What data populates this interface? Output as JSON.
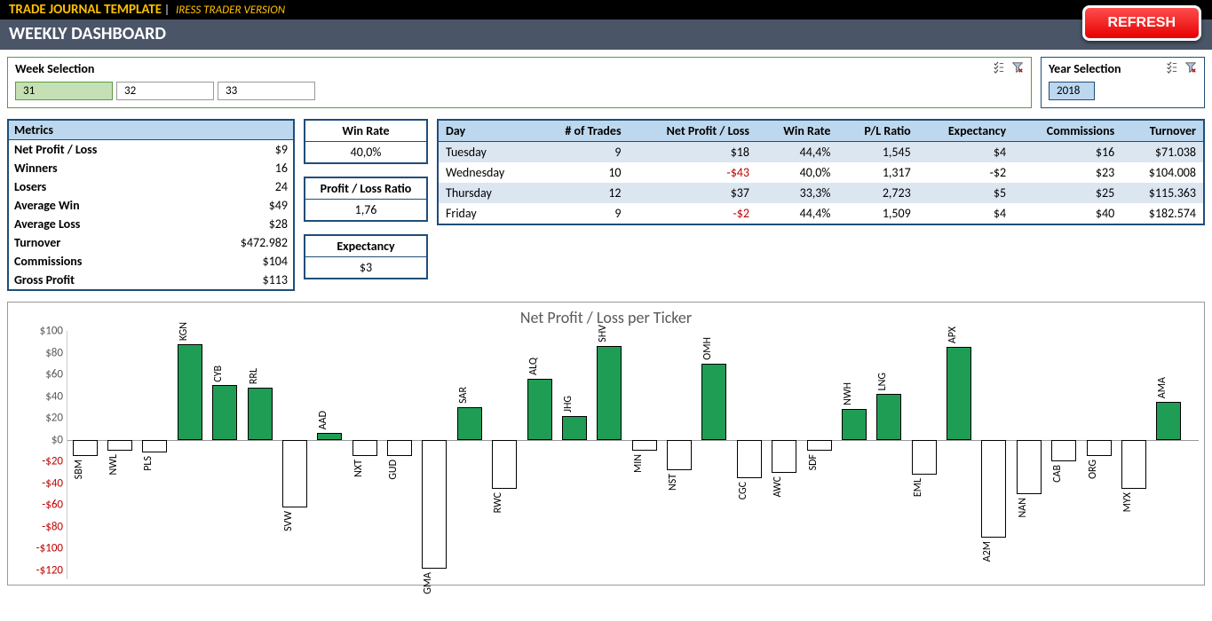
{
  "header": {
    "title": "TRADE JOURNAL TEMPLATE",
    "separator": "|",
    "subtitle": "IRESS TRADER VERSION",
    "dashboard_title": "WEEKLY DASHBOARD",
    "refresh_label": "REFRESH"
  },
  "week_selection": {
    "title": "Week Selection",
    "items": [
      "31",
      "32",
      "33"
    ],
    "selected_index": 0
  },
  "year_selection": {
    "title": "Year Selection",
    "items": [
      "2018"
    ]
  },
  "metrics": {
    "header": "Metrics",
    "rows": [
      {
        "label": "Net Profit / Loss",
        "value": "$9"
      },
      {
        "label": "Winners",
        "value": "16"
      },
      {
        "label": "Losers",
        "value": "24"
      },
      {
        "label": "Average Win",
        "value": "$49"
      },
      {
        "label": "Average Loss",
        "value": "$28"
      },
      {
        "label": "Turnover",
        "value": "$472.982"
      },
      {
        "label": "Commissions",
        "value": "$104"
      },
      {
        "label": "Gross Profit",
        "value": "$113"
      }
    ]
  },
  "stat_boxes": [
    {
      "title": "Win Rate",
      "value": "40,0%"
    },
    {
      "title": "Profit / Loss Ratio",
      "value": "1,76"
    },
    {
      "title": "Expectancy",
      "value": "$3"
    }
  ],
  "day_table": {
    "headers": [
      "Day",
      "# of Trades",
      "Net Profit / Loss",
      "Win Rate",
      "P/L Ratio",
      "Expectancy",
      "Commissions",
      "Turnover"
    ],
    "rows": [
      {
        "day": "Tuesday",
        "trades": "9",
        "netpl": "$18",
        "netpl_neg": false,
        "winrate": "44,4%",
        "plratio": "1,545",
        "expectancy": "$4",
        "commissions": "$16",
        "turnover": "$71.038",
        "alt": true
      },
      {
        "day": "Wednesday",
        "trades": "10",
        "netpl": "-$43",
        "netpl_neg": true,
        "winrate": "40,0%",
        "plratio": "1,317",
        "expectancy": "-$2",
        "commissions": "$23",
        "turnover": "$104.008",
        "alt": false
      },
      {
        "day": "Thursday",
        "trades": "12",
        "netpl": "$37",
        "netpl_neg": false,
        "winrate": "33,3%",
        "plratio": "2,723",
        "expectancy": "$5",
        "commissions": "$25",
        "turnover": "$115.363",
        "alt": true
      },
      {
        "day": "Friday",
        "trades": "9",
        "netpl": "-$2",
        "netpl_neg": true,
        "winrate": "44,4%",
        "plratio": "1,509",
        "expectancy": "$4",
        "commissions": "$40",
        "turnover": "$182.574",
        "alt": false
      }
    ]
  },
  "chart_data": {
    "type": "bar",
    "title": "Net Profit / Loss per Ticker",
    "ylabel": "",
    "xlabel": "",
    "ylim": [
      -120,
      100
    ],
    "y_ticks": [
      100,
      80,
      60,
      40,
      20,
      0,
      -20,
      -40,
      -60,
      -80,
      -100,
      -120
    ],
    "y_tick_labels": [
      "$100",
      "$80",
      "$60",
      "$40",
      "$20",
      "$0",
      "-$20",
      "-$40",
      "-$60",
      "-$80",
      "-$100",
      "-$120"
    ],
    "categories": [
      "SBM",
      "NWL",
      "PLS",
      "KGN",
      "CYB",
      "RRL",
      "SVW",
      "AAD",
      "NXT",
      "GUD",
      "GMA",
      "SAR",
      "RWC",
      "ALQ",
      "JHG",
      "SHV",
      "MIN",
      "NST",
      "OMH",
      "CGC",
      "AWC",
      "SDF",
      "NWH",
      "LNG",
      "EML",
      "APX",
      "A2M",
      "NAN",
      "CAB",
      "ORG",
      "MYX",
      "AMA"
    ],
    "values": [
      -15,
      -10,
      -12,
      88,
      50,
      48,
      -62,
      6,
      -15,
      -15,
      -118,
      30,
      -45,
      56,
      22,
      86,
      -10,
      -28,
      70,
      -35,
      -30,
      -10,
      28,
      42,
      -32,
      85,
      -90,
      -50,
      -20,
      -15,
      -45,
      35
    ]
  }
}
